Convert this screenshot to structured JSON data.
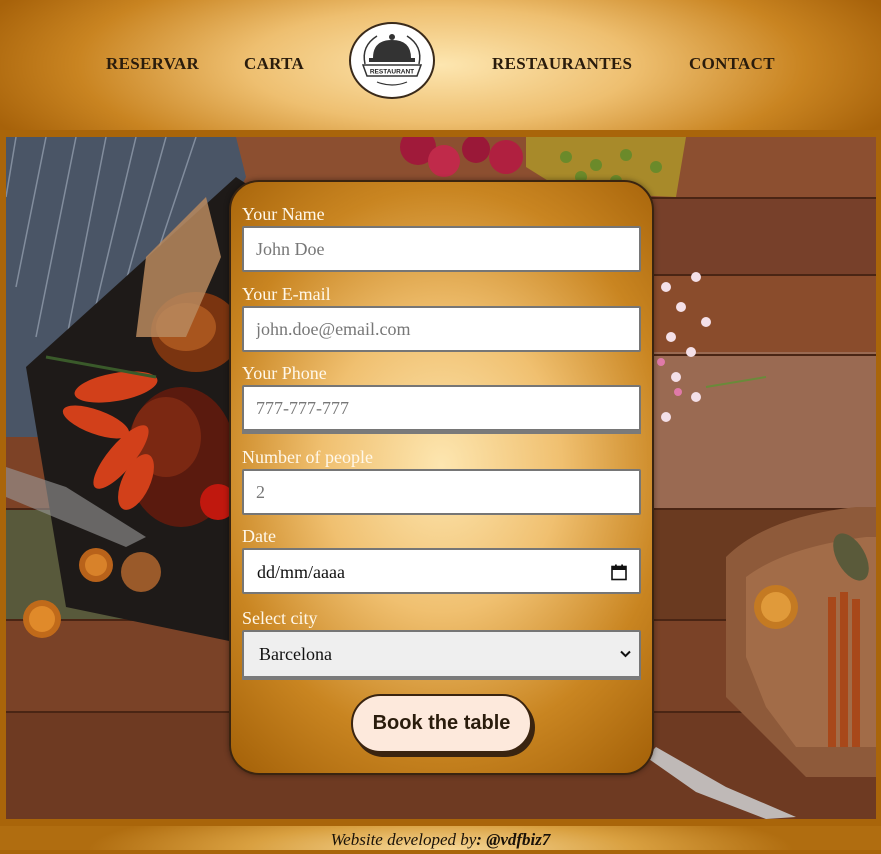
{
  "nav": {
    "reservar": "RESERVAR",
    "carta": "CARTA",
    "restaurantes": "RESTAURANTES",
    "contact": "CONTACT"
  },
  "logo": {
    "text": "RESTAURANT",
    "icon": "cloche-icon"
  },
  "form": {
    "name_label": "Your Name",
    "name_placeholder": "John Doe",
    "email_label": "Your E-mail",
    "email_placeholder": "john.doe@email.com",
    "phone_label": "Your Phone",
    "phone_placeholder": "777-777-777",
    "people_label": "Number of people",
    "people_placeholder": "2",
    "date_label": "Date",
    "date_value": "dd/mm/aaaa",
    "city_label": "Select city",
    "city_value": "Barcelona",
    "submit_label": "Book the table"
  },
  "footer": {
    "prefix": "Website developed by",
    "handle": ": @vdfbiz7"
  },
  "colors": {
    "brand_gold": "#c98521",
    "brand_light": "#fde6b0",
    "button_bg": "#fde9dc"
  }
}
